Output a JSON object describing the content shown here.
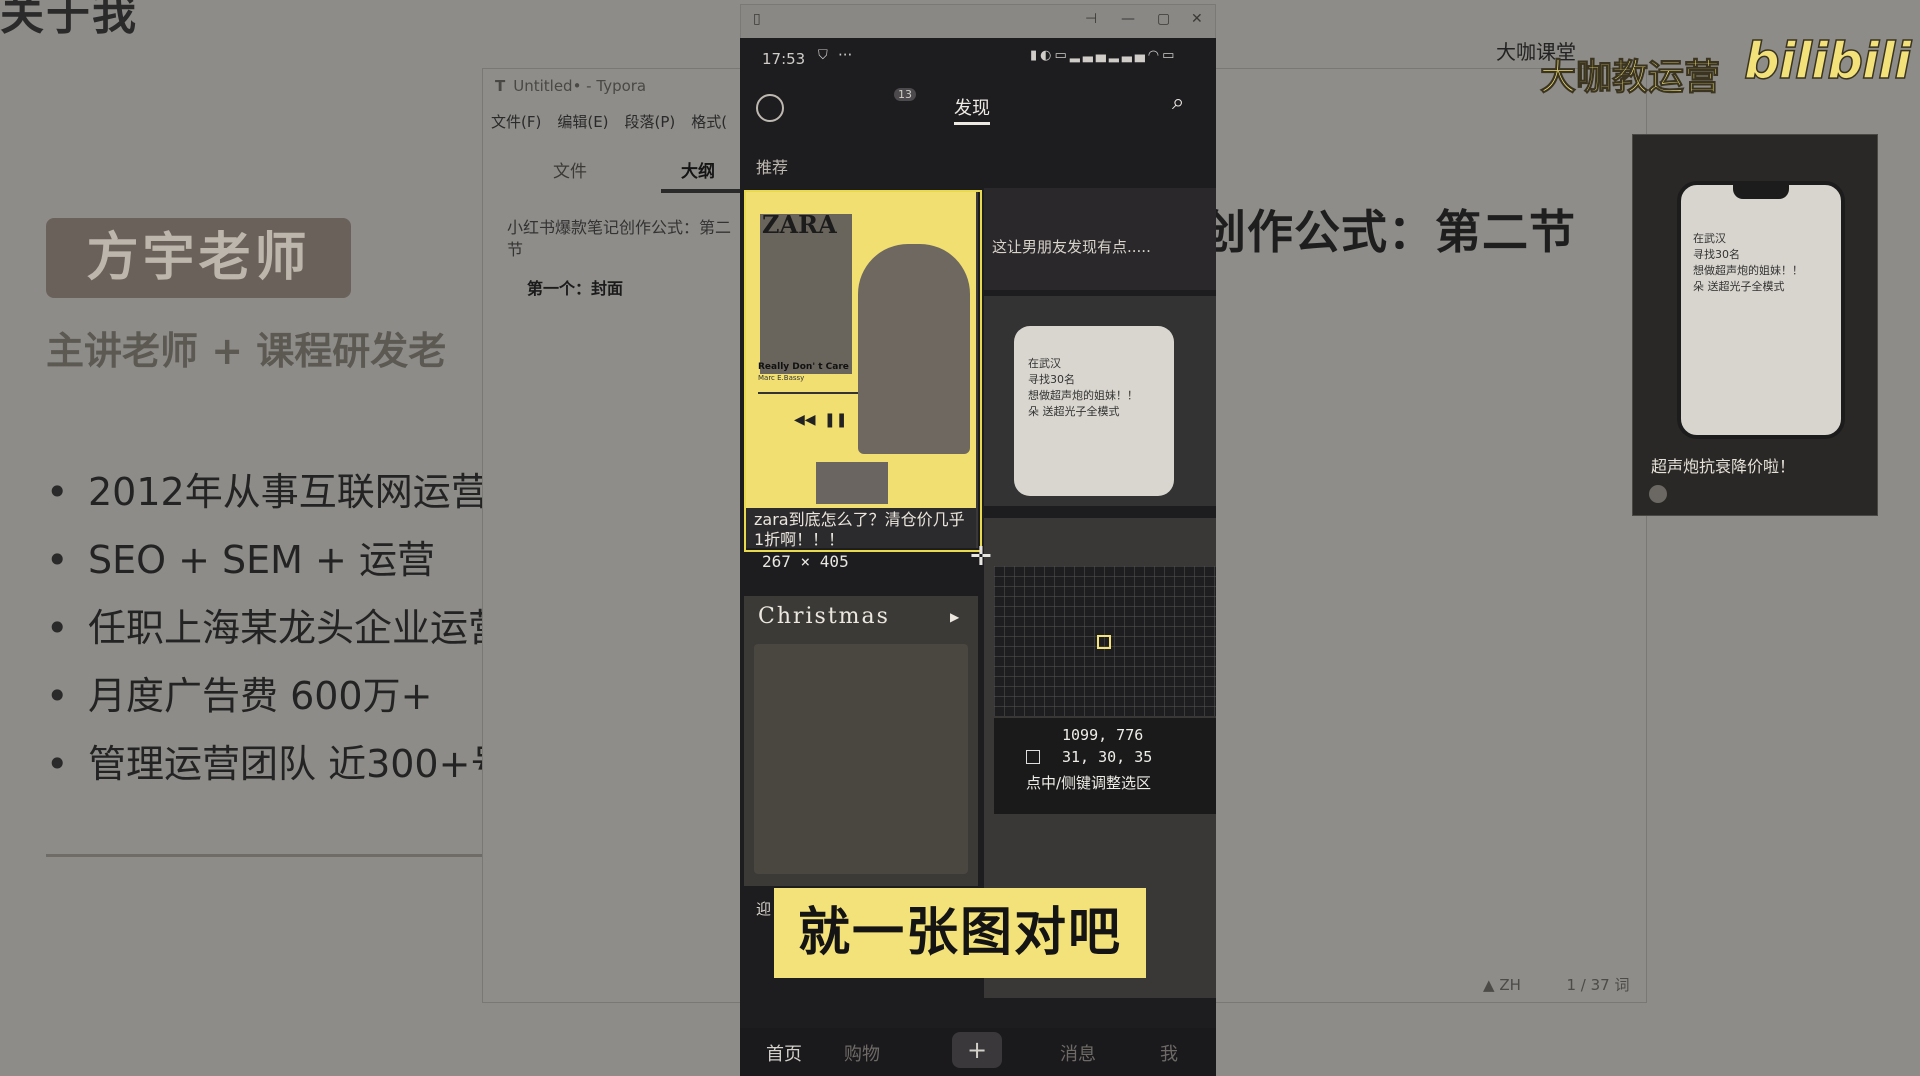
{
  "slide": {
    "heading_fragment": "关于我",
    "teacher_name": "方宇老师",
    "teacher_subtitle": "主讲老师 + 课程研发老",
    "bullets": [
      "2012年从事互联网运营",
      "SEO + SEM + 运营",
      "任职上海某龙头企业运营",
      "月度广告费 600万+",
      "管理运营团队 近300+号"
    ],
    "right_title": "创作公式：第二节"
  },
  "typora": {
    "title": "Untitled• - Typora",
    "app_glyph": "T",
    "menu": [
      "文件(F)",
      "编辑(E)",
      "段落(P)",
      "格式("
    ],
    "tabs": [
      "文件",
      "大纲"
    ],
    "outline_title": "小红书爆款笔记创作公式：第二节",
    "outline_item": "第一个：封面",
    "status_lang": "ZH",
    "status_words": "1 / 37 词"
  },
  "phone": {
    "time": "17:53",
    "nav": {
      "badge": "13",
      "tab_active": "发现"
    },
    "chips": [
      "推荐"
    ],
    "cards": [
      {
        "title": "zara到底怎么了？清仓价几乎1折啊！！！",
        "music_title": "Really Don' t Care",
        "music_artist": "Marc E.Bassy"
      },
      {
        "title": "这让男朋友发现有点....."
      },
      {
        "phone_note": [
          "在武汉",
          "寻找30名",
          "想做超声炮的姐妹！！",
          "朵 送超光子全模式"
        ]
      },
      {
        "title": "Christmas"
      },
      {
        "title": "迎"
      }
    ],
    "bottom_nav": [
      "首页",
      "购物",
      "+",
      "消息",
      "我"
    ]
  },
  "overlay": {
    "selection_size": "267 × 405",
    "magnifier_coords": "1099, 776",
    "magnifier_rgb": "31,  30,  35",
    "magnifier_hint": "点中/侧键调整选区",
    "subtitle": "就一张图对吧"
  },
  "brand": {
    "top": "大咖课堂",
    "main": "大咖教运营",
    "logo": "bilibili"
  },
  "right_shot": {
    "note": [
      "在武汉",
      "寻找30名",
      "想做超声炮的姐妹！！",
      "朵 送超光子全模式"
    ],
    "title": "超声炮抗衰降价啦！"
  },
  "colors": {
    "accent_yellow": "#f3e27a",
    "phone_bg": "#1d1c1f",
    "dim_overlay": "#8e8c88"
  }
}
